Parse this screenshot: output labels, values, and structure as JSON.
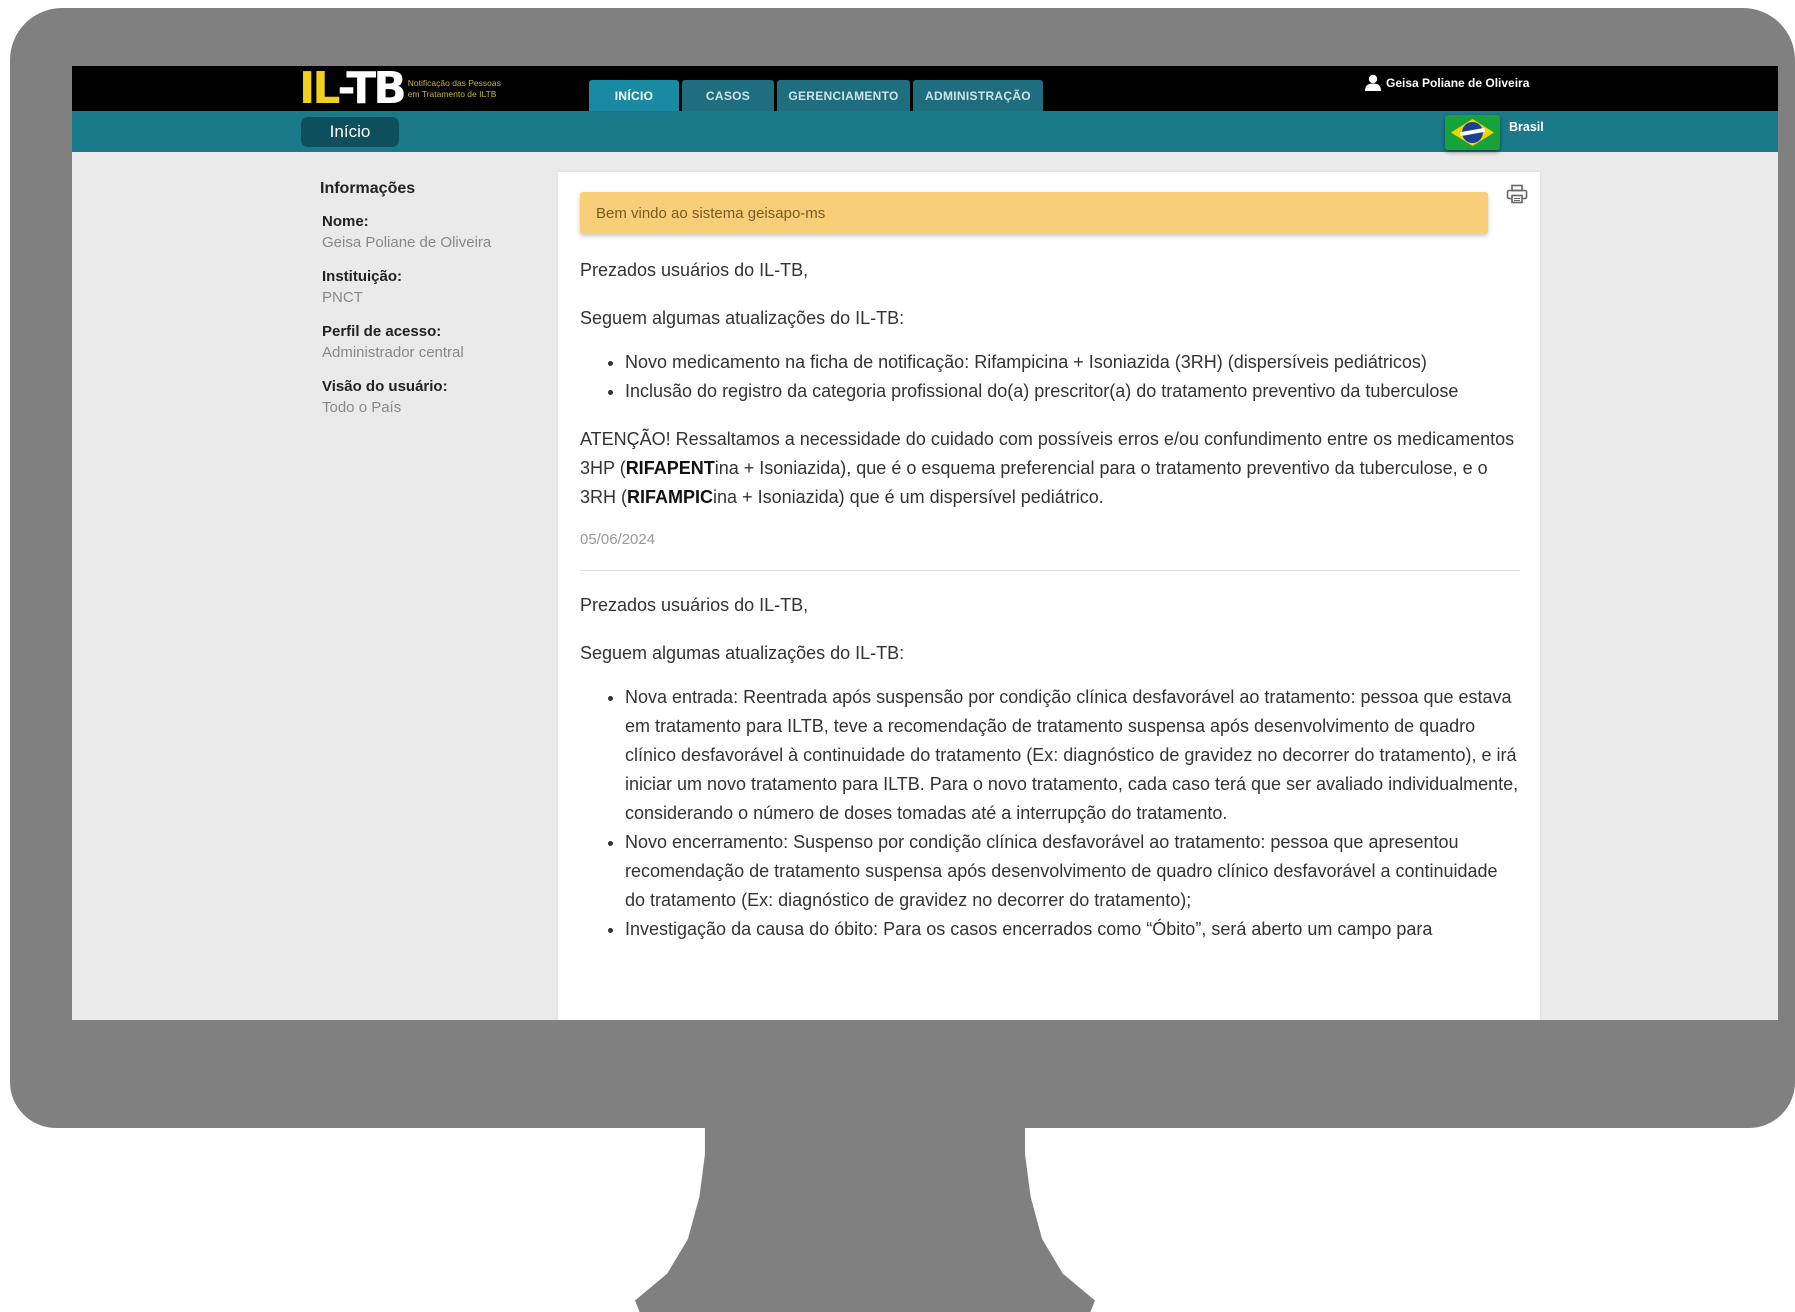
{
  "header": {
    "logo_text": "IL-TB",
    "logo_il": "IL",
    "logo_rest": "-TB",
    "logo_subtitle": "Notificação das Pessoas em Tratamento de ILTB",
    "user_name": "Geisa Poliane de Oliveira"
  },
  "nav": {
    "tabs": [
      "INÍCIO",
      "CASOS",
      "GERENCIAMENTO",
      "ADMINISTRAÇÃO"
    ],
    "active": "INÍCIO"
  },
  "subbar": {
    "breadcrumb": "Início",
    "country": "Brasil"
  },
  "sidebar": {
    "title": "Informações",
    "fields": [
      {
        "label": "Nome:",
        "value": "Geisa Poliane de Oliveira"
      },
      {
        "label": "Instituição:",
        "value": "PNCT"
      },
      {
        "label": "Perfil de acesso:",
        "value": "Administrador central"
      },
      {
        "label": "Visão do usuário:",
        "value": "Todo o País"
      }
    ]
  },
  "content": {
    "welcome": "Bem vindo ao sistema geisapo-ms",
    "news1": {
      "greeting": "Prezados usuários do IL-TB,",
      "intro": "Seguem algumas atualizações do IL-TB:",
      "items": [
        "Novo medicamento na ficha de notificação: Rifampicina + Isoniazida (3RH) (dispersíveis pediátricos)",
        "Inclusão do registro da categoria profissional do(a) prescritor(a) do tratamento preventivo da tuberculose"
      ],
      "attention": {
        "part1": "ATENÇÃO! Ressaltamos a necessidade do cuidado com possíveis erros e/ou confundimento entre os medicamentos 3HP (",
        "bold1": "RIFAPENT",
        "part2": "ina + Isoniazida), que é o esquema preferencial para o tratamento preventivo da tuberculose, e o 3RH (",
        "bold2": "RIFAMPIC",
        "part3": "ina + Isoniazida) que é um dispersível pediátrico."
      },
      "date": "05/06/2024"
    },
    "news2": {
      "greeting": "Prezados usuários do IL-TB,",
      "intro": "Seguem algumas atualizações do IL-TB:",
      "items": [
        "Nova entrada: Reentrada após suspensão por condição clínica desfavorável ao tratamento: pessoa que estava em tratamento para ILTB, teve a recomendação de tratamento suspensa após desenvolvimento de quadro clínico desfavorável à continuidade do tratamento (Ex: diagnóstico de gravidez no decorrer do tratamento), e irá iniciar um novo tratamento para ILTB. Para o novo tratamento, cada caso terá que ser avaliado individualmente, considerando o número de doses tomadas até a interrupção do tratamento.",
        "Novo encerramento: Suspenso por condição clínica desfavorável ao tratamento: pessoa que apresentou recomendação de tratamento suspensa após desenvolvimento de quadro clínico desfavorável a continuidade do tratamento (Ex: diagnóstico de gravidez no decorrer do tratamento);",
        "Investigação da causa do óbito: Para os casos encerrados como “Óbito”, será aberto um campo para"
      ]
    }
  },
  "colors": {
    "topbar": "#000000",
    "subbar": "#1a7a8a",
    "tab": "#1e6e7f",
    "tab_active": "#1a8aa3",
    "welcome_bg": "#f8cf78",
    "logo_yellow": "#f2d020",
    "monitor": "#808080"
  },
  "icons": [
    "user-icon",
    "print-icon",
    "brazil-flag-icon"
  ]
}
